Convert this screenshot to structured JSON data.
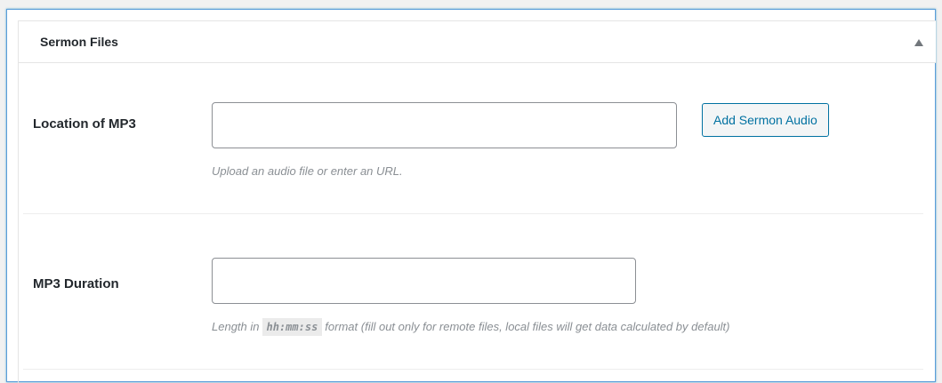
{
  "metabox": {
    "title": "Sermon Files",
    "toggle_icon": "triangle-up-icon"
  },
  "fields": {
    "mp3_location": {
      "label": "Location of MP3",
      "value": "",
      "placeholder": "",
      "button_label": "Add Sermon Audio",
      "description": "Upload an audio file or enter an URL."
    },
    "mp3_duration": {
      "label": "MP3 Duration",
      "value": "",
      "placeholder": "",
      "description_prefix": "Length in",
      "description_code": "hh:mm:ss",
      "description_suffix": "format (fill out only for remote files, local files will get data calculated by default)"
    }
  },
  "colors": {
    "accent": "#0071a1",
    "focus_border": "#5b9dd9",
    "description_text": "#8a8f94"
  }
}
